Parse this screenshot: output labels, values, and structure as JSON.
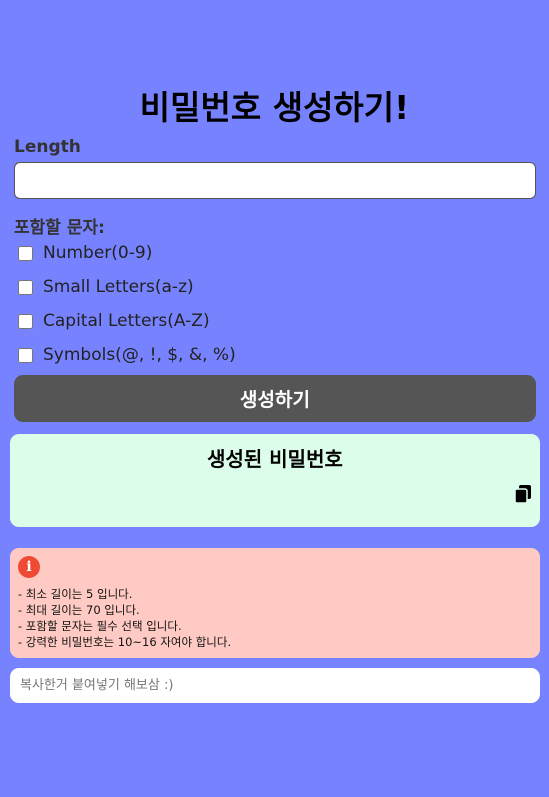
{
  "page": {
    "title": "비밀번호 생성하기!"
  },
  "form": {
    "length_label": "Length",
    "length_value": "",
    "include_label": "포함할 문자:",
    "options": [
      {
        "label": "Number(0-9)",
        "checked": false
      },
      {
        "label": "Small Letters(a-z)",
        "checked": false
      },
      {
        "label": "Capital Letters(A-Z)",
        "checked": false
      },
      {
        "label": "Symbols(@, !, $, &, %)",
        "checked": false
      }
    ],
    "generate_label": "생성하기"
  },
  "result": {
    "title": "생성된 비밀번호",
    "password": "",
    "copy_icon": "copy-icon"
  },
  "info": {
    "icon": "info-icon",
    "icon_glyph": "i",
    "rules": [
      "- 최소 길이는 5 입니다.",
      "- 최대 길이는 70 입니다.",
      "- 포함할 문자는 필수 선택 입니다.",
      "- 강력한 비밀번호는 10~16 자여야 합니다."
    ]
  },
  "paste": {
    "placeholder": "복사한거 붙여넣기 해보삼 :)"
  },
  "colors": {
    "background": "#7782ff",
    "button": "#555555",
    "result_box": "#dcfde9",
    "info_box": "#ffcac4",
    "info_icon": "#ee4a34"
  }
}
